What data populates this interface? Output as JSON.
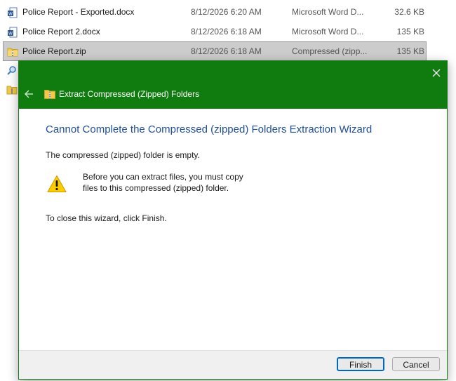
{
  "files": [
    {
      "name": "Police Report - Exported.docx",
      "date": "8/12/2026 6:20 AM",
      "type": "Microsoft Word D...",
      "size": "32.6 KB",
      "icon": "word-doc-icon",
      "selected": false
    },
    {
      "name": "Police Report 2.docx",
      "date": "8/12/2026 6:18 AM",
      "type": "Microsoft Word D...",
      "size": "135 KB",
      "icon": "word-doc-icon",
      "selected": false
    },
    {
      "name": "Police Report.zip",
      "date": "8/12/2026 6:18 AM",
      "type": "Compressed (zipp...",
      "size": "135 KB",
      "icon": "zip-folder-icon",
      "selected": true
    }
  ],
  "dialog": {
    "title": "Extract Compressed (Zipped) Folders",
    "heading": "Cannot Complete the Compressed (zipped) Folders Extraction Wizard",
    "message": "The compressed (zipped) folder is empty.",
    "warning_line1": "Before you can extract files, you must copy",
    "warning_line2": "files to this compressed (zipped) folder.",
    "instruction": "To close this wizard, click Finish.",
    "finish_label": "Finish",
    "cancel_label": "Cancel"
  },
  "colors": {
    "header_bg": "#107c10",
    "heading_text": "#1f4e9c",
    "selection_bg": "#cccccc",
    "warning_yellow": "#ffcc00"
  }
}
